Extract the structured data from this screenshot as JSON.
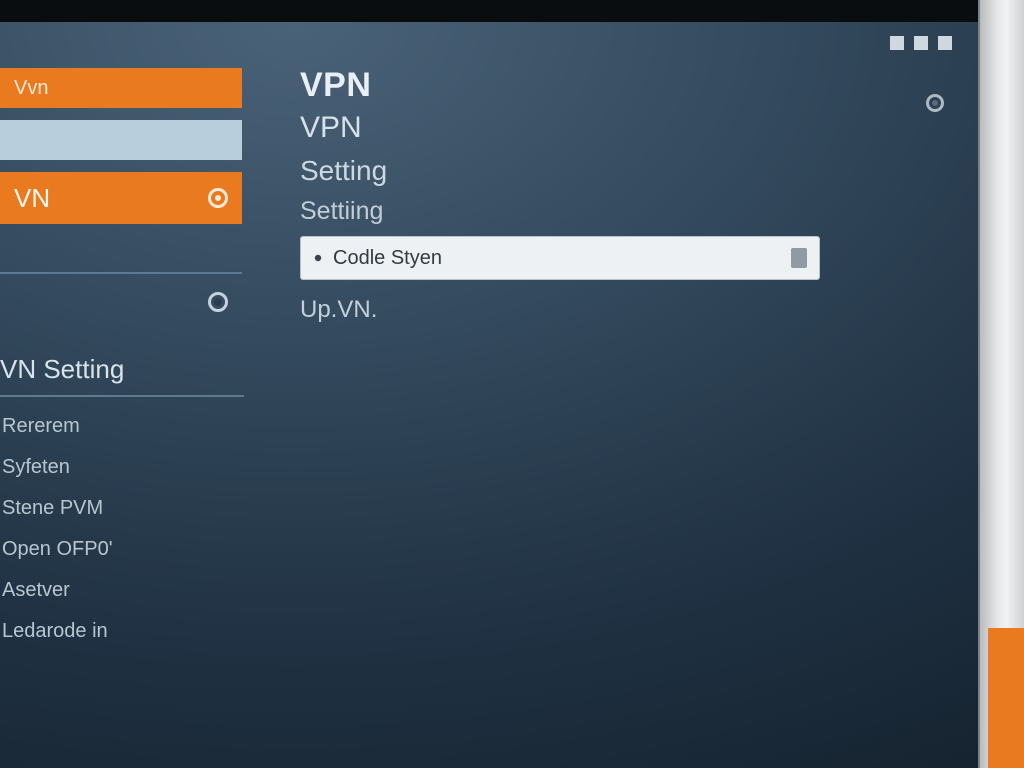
{
  "colors": {
    "accent": "#ea7a1f",
    "panel": "#2a4a63"
  },
  "window": {
    "controls": [
      "min",
      "max",
      "close"
    ]
  },
  "sidebar": {
    "top_items": [
      {
        "label": "Vvn",
        "style": "orange"
      },
      {
        "label": "",
        "style": "pale"
      },
      {
        "label": "VN",
        "style": "orange-vn"
      },
      {
        "label": "",
        "style": "thin"
      },
      {
        "label": "",
        "style": "ghost"
      }
    ],
    "section_title": "VN Setting",
    "list": [
      {
        "label": "Rererem"
      },
      {
        "label": "Syfeten"
      },
      {
        "label": "Stene PVM"
      },
      {
        "label": "Open OFP0'"
      },
      {
        "label": "Asetver"
      },
      {
        "label": "Ledarode in"
      }
    ]
  },
  "main": {
    "h1": "VPN",
    "h2": "VPN",
    "sub1": "Setting",
    "sub2": "Settiing",
    "field_value": "Codle Styen",
    "below": "Up.VN."
  }
}
